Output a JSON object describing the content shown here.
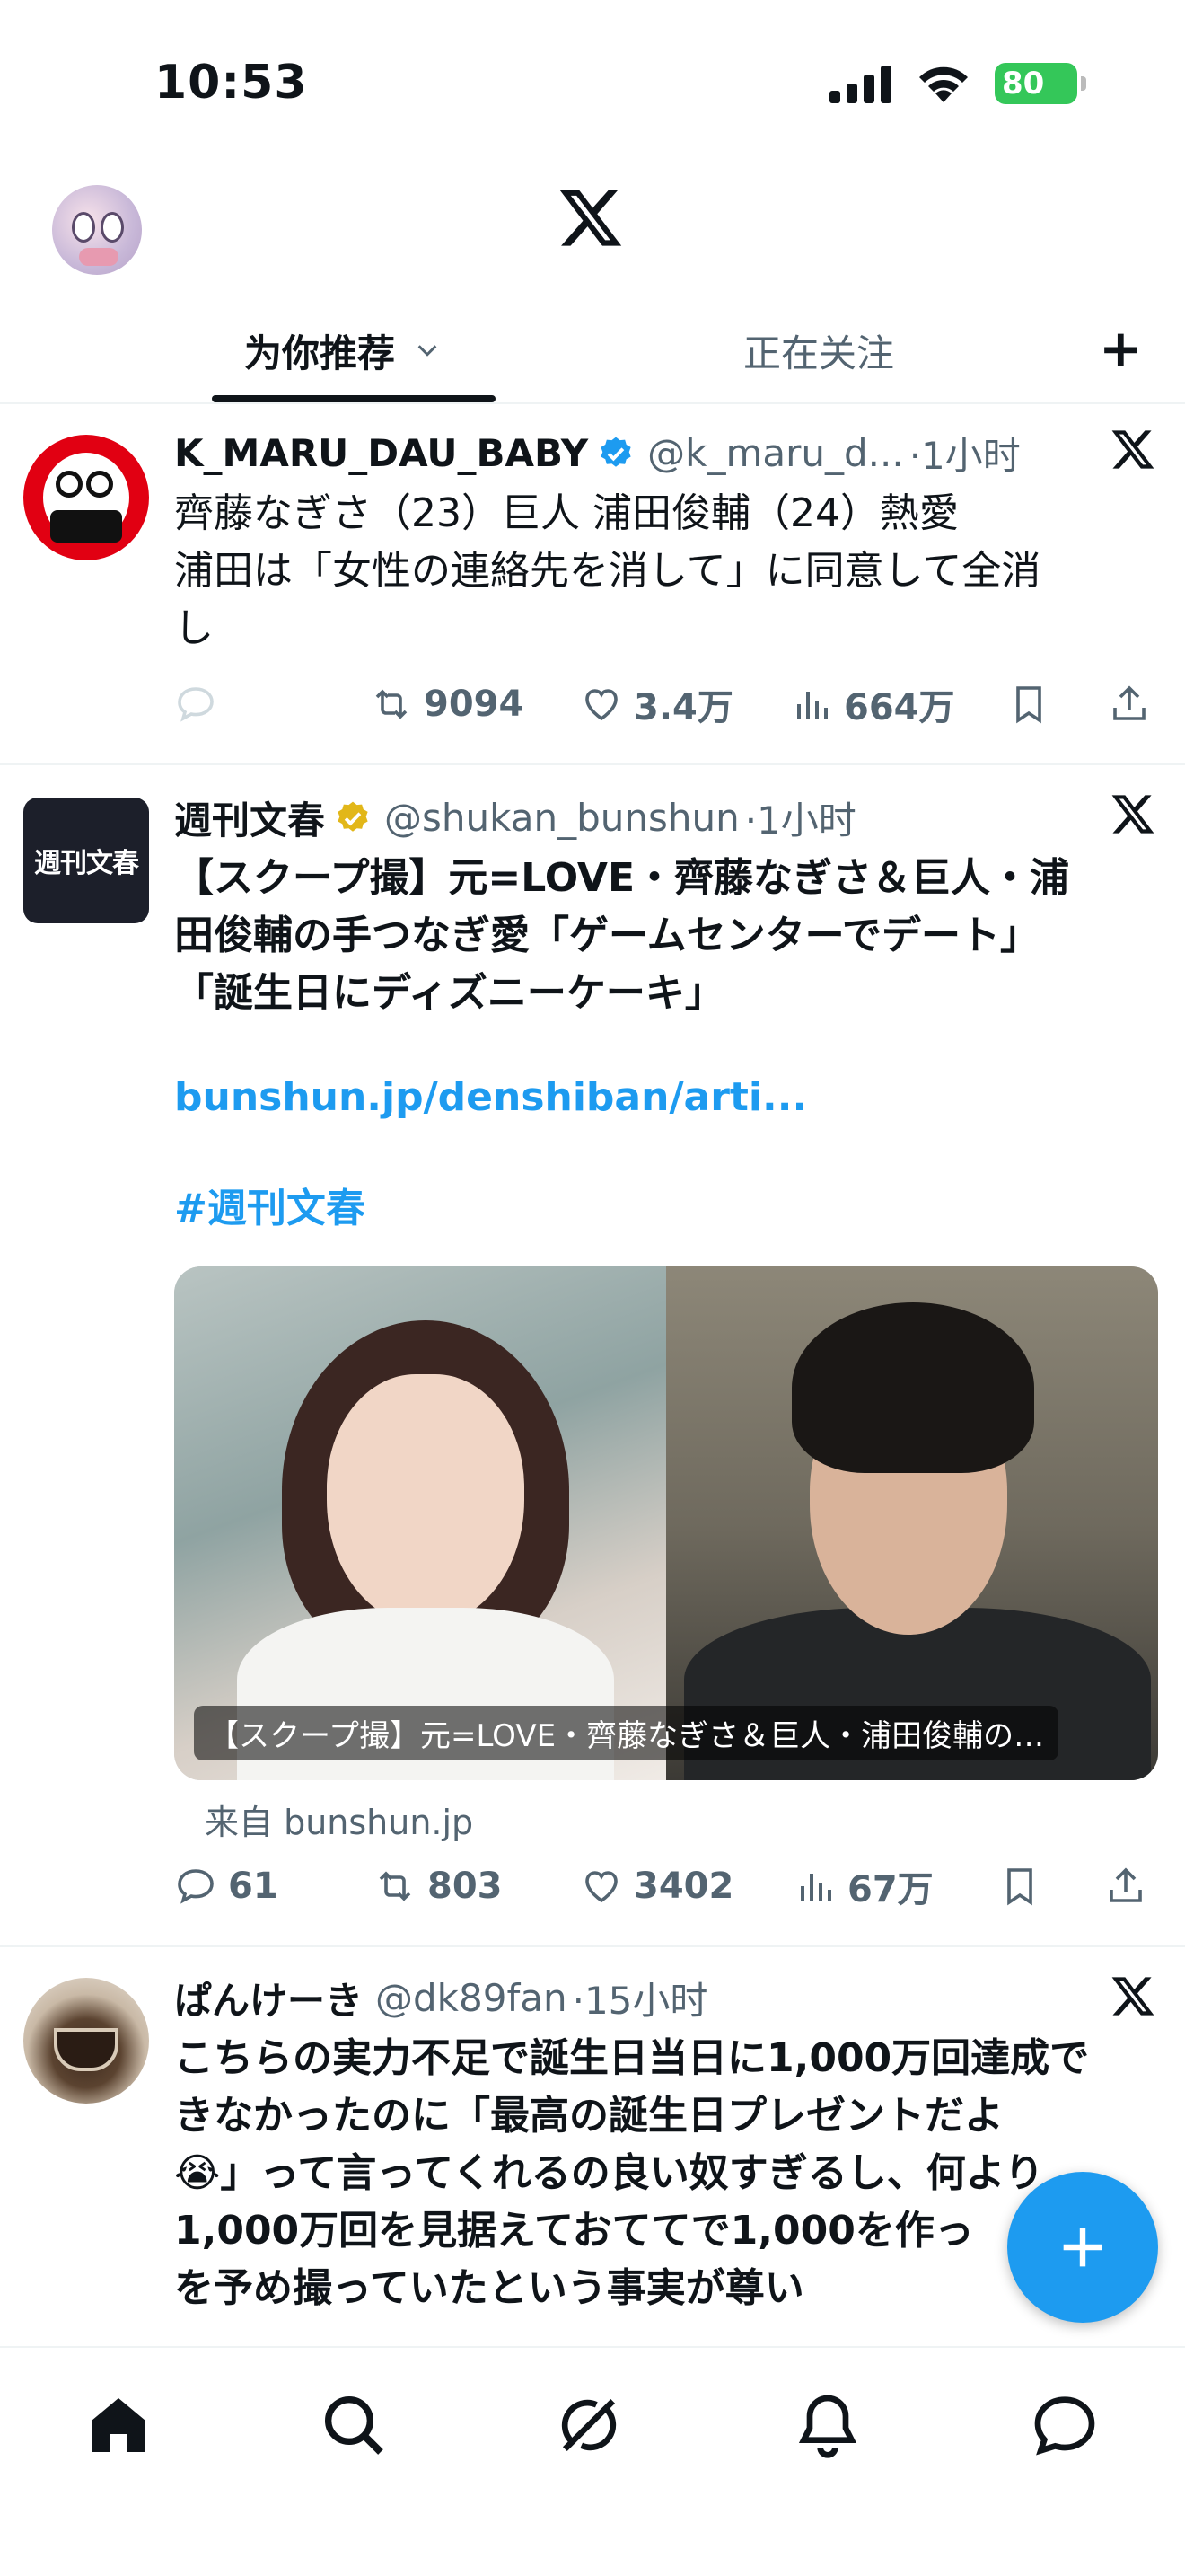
{
  "status_bar": {
    "time": "10:53",
    "battery": "80"
  },
  "header": {
    "logo": "x-logo"
  },
  "tabs": {
    "for_you": "为你推荐",
    "following": "正在关注"
  },
  "posts": [
    {
      "name": "K_MARU_DAU_BABY",
      "handle": "@k_maru_d...",
      "time": "·1小时",
      "verified": "blue",
      "text_line1": "齊藤なぎさ（23）巨人 浦田俊輔（24）熱愛",
      "text_line2": "浦田は「女性の連絡先を消して」に同意して全消",
      "text_line3": "し",
      "retweets": "9094",
      "likes": "3.4万",
      "views": "664万"
    },
    {
      "name": "週刊文春",
      "handle": "@shukan_bunshun",
      "time": "·1小时",
      "verified": "gold",
      "avatar_text": "週刊文春",
      "text_line1": "【スクープ撮】元=LOVE・齊藤なぎさ＆巨人・浦",
      "text_line2": "田俊輔の手つなぎ愛「ゲームセンターでデート」",
      "text_line3": "「誕生日にディズニーケーキ」",
      "link": "bunshun.jp/denshiban/arti...",
      "hashtag": "#週刊文春",
      "media_caption": "【スクープ撮】元=LOVE・齊藤なぎさ＆巨人・浦田俊輔の…",
      "source": "来自 bunshun.jp",
      "replies": "61",
      "retweets": "803",
      "likes": "3402",
      "views": "67万"
    },
    {
      "name": "ぱんけーき",
      "handle": "@dk89fan",
      "time": "·15小时",
      "text_line1": "こちらの実力不足で誕生日当日に1,000万回達成で",
      "text_line2": "きなかったのに「最高の誕生日プレゼントだよ",
      "text_line3": "😭」って言ってくれるの良い奴すぎるし、何より",
      "text_line4": "1,000万回を見据えておててで1,000を作っ",
      "text_line5": "を予め撮っていたという事実が尊い"
    }
  ],
  "colors": {
    "accent": "#1d9bf0",
    "verified_gold": "#e2b719",
    "text": "#0f1419",
    "muted": "#536471"
  },
  "nav": [
    "home-icon",
    "search-icon",
    "grok-icon",
    "notifications-icon",
    "messages-icon"
  ]
}
